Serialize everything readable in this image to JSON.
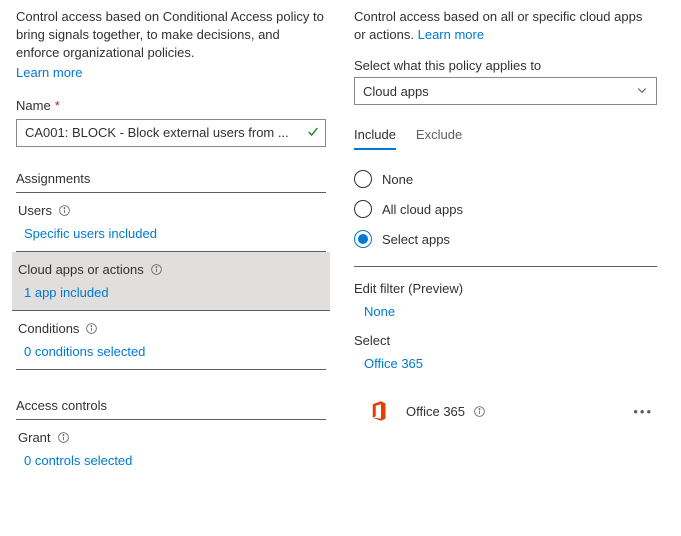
{
  "left": {
    "description": "Control access based on Conditional Access policy to bring signals together, to make decisions, and enforce organizational policies.",
    "learn_more": "Learn more",
    "name_label": "Name",
    "name_value": "CA001: BLOCK - Block external users from ...",
    "assignments_header": "Assignments",
    "users": {
      "label": "Users",
      "value": "Specific users included"
    },
    "cloud_apps": {
      "label": "Cloud apps or actions",
      "value": "1 app included"
    },
    "conditions": {
      "label": "Conditions",
      "value": "0 conditions selected"
    },
    "access_controls_header": "Access controls",
    "grant": {
      "label": "Grant",
      "value": "0 controls selected"
    }
  },
  "right": {
    "description": "Control access based on all or specific cloud apps or actions.",
    "learn_more": "Learn more",
    "applies_label": "Select what this policy applies to",
    "applies_value": "Cloud apps",
    "tabs": {
      "include": "Include",
      "exclude": "Exclude"
    },
    "radio": {
      "none": "None",
      "all": "All cloud apps",
      "select": "Select apps"
    },
    "filter": {
      "label": "Edit filter (Preview)",
      "value": "None"
    },
    "select": {
      "label": "Select",
      "value": "Office 365"
    },
    "app": {
      "name": "Office 365"
    }
  }
}
